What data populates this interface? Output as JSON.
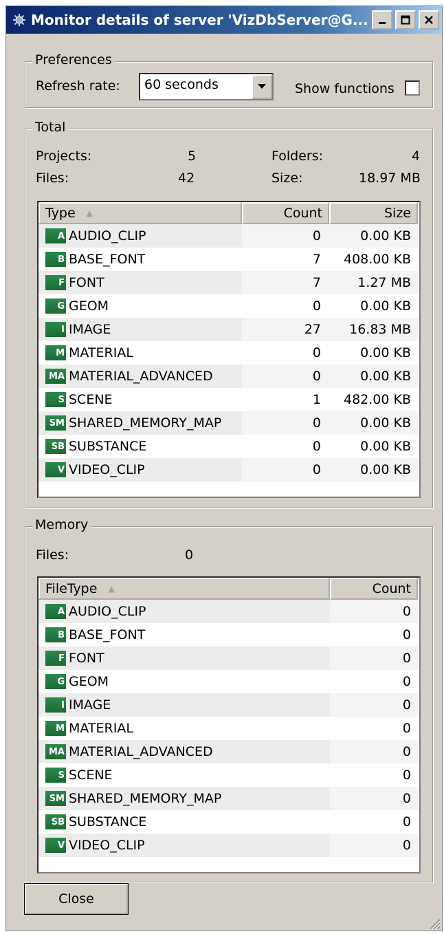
{
  "window": {
    "title": "Monitor details of server 'VizDbServer@G...",
    "controls": [
      "minimize",
      "maximize",
      "close"
    ]
  },
  "preferences": {
    "legend": "Preferences",
    "refresh_label": "Refresh rate:",
    "refresh_value": "60 seconds",
    "show_functions_label": "Show functions",
    "show_functions_checked": false
  },
  "total": {
    "legend": "Total",
    "projects_label": "Projects:",
    "projects_value": "5",
    "folders_label": "Folders:",
    "folders_value": "4",
    "files_label": "Files:",
    "files_value": "42",
    "size_label": "Size:",
    "size_value": "18.97 MB",
    "columns": [
      "Type",
      "Count",
      "Size"
    ],
    "rows": [
      {
        "icon": "A",
        "type": "AUDIO_CLIP",
        "count": "0",
        "size": "0.00 KB"
      },
      {
        "icon": "B",
        "type": "BASE_FONT",
        "count": "7",
        "size": "408.00 KB"
      },
      {
        "icon": "F",
        "type": "FONT",
        "count": "7",
        "size": "1.27 MB"
      },
      {
        "icon": "G",
        "type": "GEOM",
        "count": "0",
        "size": "0.00 KB"
      },
      {
        "icon": "I",
        "type": "IMAGE",
        "count": "27",
        "size": "16.83 MB"
      },
      {
        "icon": "M",
        "type": "MATERIAL",
        "count": "0",
        "size": "0.00 KB"
      },
      {
        "icon": "MA",
        "type": "MATERIAL_ADVANCED",
        "count": "0",
        "size": "0.00 KB"
      },
      {
        "icon": "S",
        "type": "SCENE",
        "count": "1",
        "size": "482.00 KB"
      },
      {
        "icon": "SM",
        "type": "SHARED_MEMORY_MAP",
        "count": "0",
        "size": "0.00 KB"
      },
      {
        "icon": "SB",
        "type": "SUBSTANCE",
        "count": "0",
        "size": "0.00 KB"
      },
      {
        "icon": "V",
        "type": "VIDEO_CLIP",
        "count": "0",
        "size": "0.00 KB"
      }
    ]
  },
  "memory": {
    "legend": "Memory",
    "files_label": "Files:",
    "files_value": "0",
    "columns": [
      "FileType",
      "Count"
    ],
    "rows": [
      {
        "icon": "A",
        "type": "AUDIO_CLIP",
        "count": "0"
      },
      {
        "icon": "B",
        "type": "BASE_FONT",
        "count": "0"
      },
      {
        "icon": "F",
        "type": "FONT",
        "count": "0"
      },
      {
        "icon": "G",
        "type": "GEOM",
        "count": "0"
      },
      {
        "icon": "I",
        "type": "IMAGE",
        "count": "0"
      },
      {
        "icon": "M",
        "type": "MATERIAL",
        "count": "0"
      },
      {
        "icon": "MA",
        "type": "MATERIAL_ADVANCED",
        "count": "0"
      },
      {
        "icon": "S",
        "type": "SCENE",
        "count": "0"
      },
      {
        "icon": "SM",
        "type": "SHARED_MEMORY_MAP",
        "count": "0"
      },
      {
        "icon": "SB",
        "type": "SUBSTANCE",
        "count": "0"
      },
      {
        "icon": "V",
        "type": "VIDEO_CLIP",
        "count": "0"
      }
    ]
  },
  "footer": {
    "close_label": "Close"
  },
  "colors": {
    "titlebar_start": "#0a246a",
    "titlebar_end": "#a6caf0",
    "dialog_bg": "#d4d0c8",
    "icon_green": "#2c8a4a",
    "row_shade": "#ececec"
  }
}
